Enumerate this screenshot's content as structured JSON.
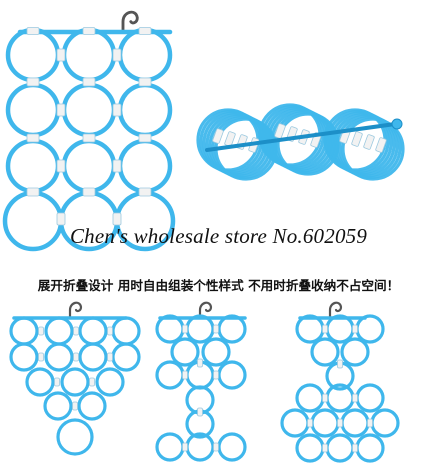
{
  "watermark": {
    "text": "Chen's wholesale store No.602059"
  },
  "caption": {
    "text": "展开折叠设计 用时自由组装个性样式 不用时折叠收纳不占空间！"
  },
  "colors": {
    "ring": "#3fb7ec",
    "ring_dark": "#1c8fc8",
    "clip": "#f2f2f2",
    "clip_edge": "#9cc9df"
  },
  "products": [
    {
      "name": "hanger-main-flat",
      "layout": "4x3-grid"
    },
    {
      "name": "hanger-folded",
      "layout": "folded-stack"
    },
    {
      "name": "hanger-variant-a",
      "layout": "pyramid-down"
    },
    {
      "name": "hanger-variant-b",
      "layout": "hourglass"
    },
    {
      "name": "hanger-variant-c",
      "layout": "diamond-base"
    }
  ]
}
